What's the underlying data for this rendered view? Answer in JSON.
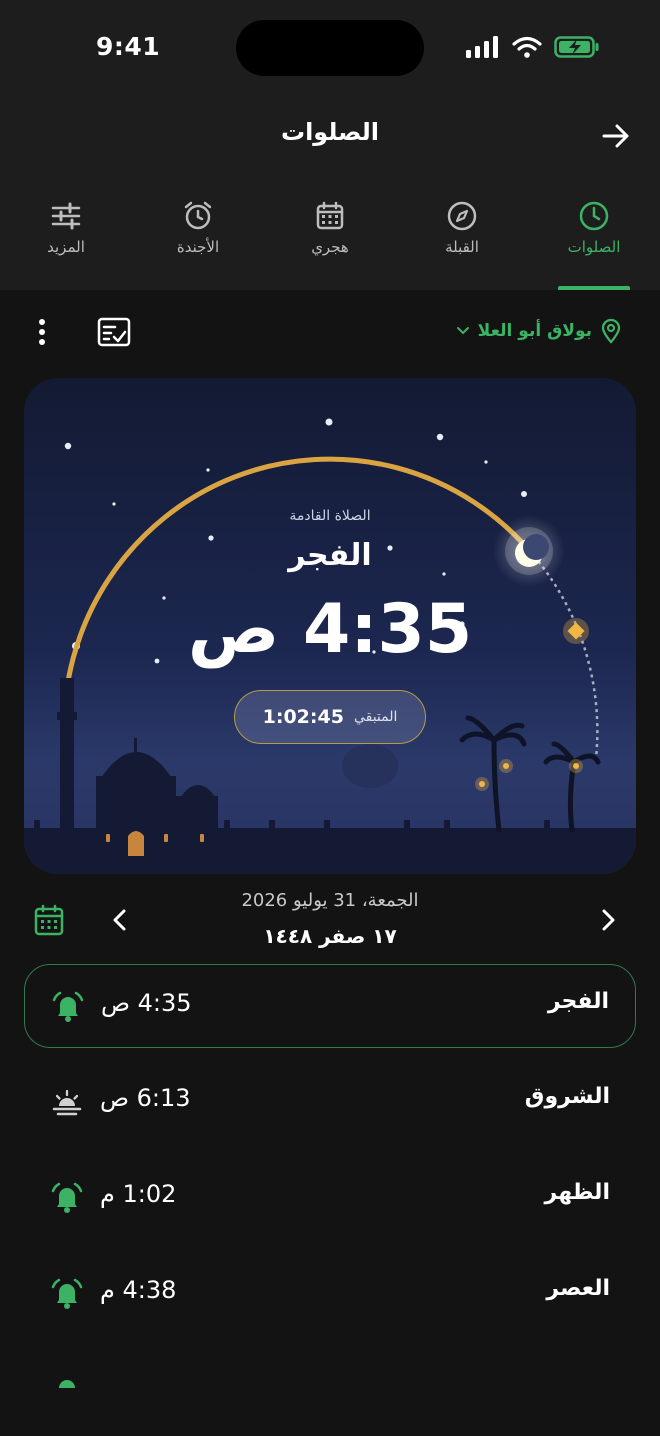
{
  "status_bar": {
    "time": "9:41"
  },
  "header": {
    "title": "الصلوات"
  },
  "tabs": [
    {
      "label": "الصلوات",
      "icon": "clock-icon",
      "active": true
    },
    {
      "label": "القبلة",
      "icon": "compass-icon",
      "active": false
    },
    {
      "label": "هجري",
      "icon": "calendar-icon",
      "active": false
    },
    {
      "label": "الأجندة",
      "icon": "alarm-clock-icon",
      "active": false
    },
    {
      "label": "المزيد",
      "icon": "sliders-icon",
      "active": false
    }
  ],
  "location": {
    "name": "بولاق أبو العلا"
  },
  "next_prayer": {
    "label": "الصلاة القادمة",
    "name": "الفجر",
    "time": "4:35 ص",
    "remaining_label": "المتبقي",
    "remaining_value": "1:02:45"
  },
  "date": {
    "gregorian": "الجمعة، 31 يوليو 2026",
    "hijri": "١٧ صفر ١٤٤٨"
  },
  "prayers": [
    {
      "name": "الفجر",
      "time": "4:35 ص",
      "icon": "alarm-bell-icon",
      "next": true
    },
    {
      "name": "الشروق",
      "time": "6:13 ص",
      "icon": "sunrise-icon",
      "next": false
    },
    {
      "name": "الظهر",
      "time": "1:02 م",
      "icon": "alarm-bell-icon",
      "next": false
    },
    {
      "name": "العصر",
      "time": "4:38 م",
      "icon": "alarm-bell-icon",
      "next": false
    }
  ],
  "colors": {
    "accent": "#3cb265",
    "gold": "#d9a441",
    "background": "#131313",
    "header": "#1d1d1d"
  }
}
